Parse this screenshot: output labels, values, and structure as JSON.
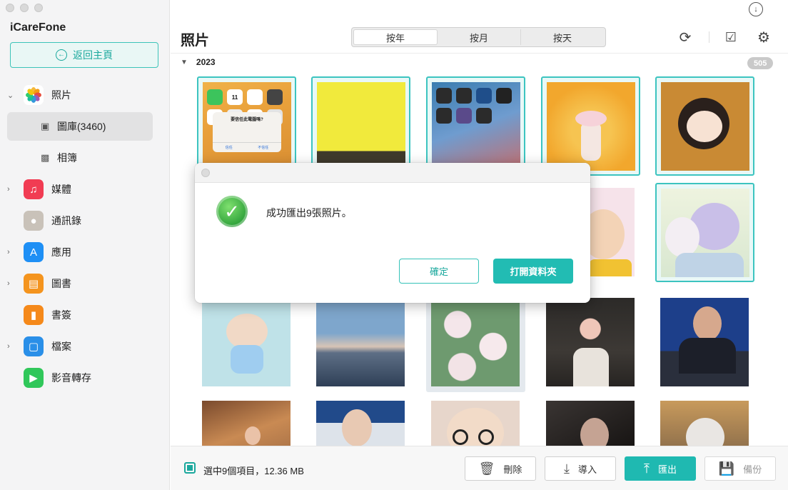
{
  "app": {
    "title": "iCareFone",
    "back_label": "返回主頁"
  },
  "sidebar": {
    "items": [
      {
        "name": "照片",
        "icon": "photos-icon",
        "color": "#f0f0f0",
        "expandable": true
      },
      {
        "name": "媒體",
        "icon": "music-icon",
        "color": "#f13c53",
        "expandable": true
      },
      {
        "name": "通訊錄",
        "icon": "contacts-icon",
        "color": "#bdb6ad",
        "expandable": false
      },
      {
        "name": "應用",
        "icon": "appstore-icon",
        "color": "#1e8ff5",
        "expandable": true
      },
      {
        "name": "圖書",
        "icon": "books-icon",
        "color": "#f4941e",
        "expandable": true
      },
      {
        "name": "書簽",
        "icon": "bookmark-icon",
        "color": "#f5891a",
        "expandable": false
      },
      {
        "name": "檔案",
        "icon": "files-icon",
        "color": "#2a8fe8",
        "expandable": true
      },
      {
        "name": "影音轉存",
        "icon": "video-transfer-icon",
        "color": "#30c75a",
        "expandable": false
      }
    ],
    "sub_items": [
      {
        "label": "圖庫(3460)",
        "icon": "gallery-icon",
        "active": true
      },
      {
        "label": "相簿",
        "icon": "album-icon",
        "active": false
      }
    ]
  },
  "header": {
    "title": "照片",
    "tabs": [
      "按年",
      "按月",
      "按天"
    ],
    "active_tab": "按年"
  },
  "gallery": {
    "year": "2023",
    "count": "505"
  },
  "bottom": {
    "selection_text": "選中9個項目，12.36 MB",
    "delete_label": "刪除",
    "import_label": "導入",
    "export_label": "匯出",
    "backup_label": "備份"
  },
  "dialog": {
    "message": "成功匯出9張照片。",
    "ok_label": "確定",
    "open_folder_label": "打開資料夾"
  },
  "phone_dialog": {
    "title": "要信任此電腦嗎?",
    "trust": "信任",
    "dont_trust": "不信任"
  },
  "thumb_numeral": "11",
  "colors": {
    "accent": "#1fb9b1",
    "accent_light": "#e9f7f5",
    "badge": "#c9c9c9"
  }
}
